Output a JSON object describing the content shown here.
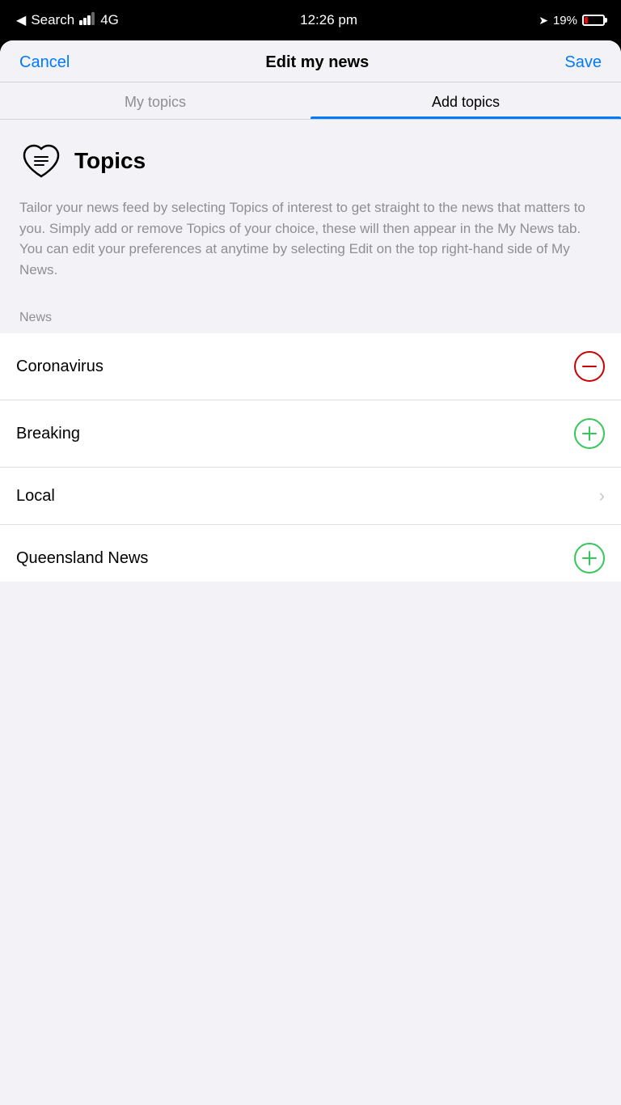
{
  "statusBar": {
    "carrier": "Search",
    "signal": "●●●●",
    "network": "4G",
    "time": "12:26 pm",
    "locationIcon": "▷",
    "battery": "19%"
  },
  "navBar": {
    "cancelLabel": "Cancel",
    "title": "Edit my news",
    "saveLabel": "Save"
  },
  "tabs": [
    {
      "id": "my-topics",
      "label": "My topics",
      "active": false
    },
    {
      "id": "add-topics",
      "label": "Add topics",
      "active": true
    }
  ],
  "topicsSection": {
    "heading": "Topics",
    "description": "Tailor your news feed by selecting Topics of interest to get straight to the news that matters to you. Simply add or remove Topics of your choice, these will then appear in the My News tab. You can edit your preferences at anytime by selecting Edit on the top right-hand side of My News."
  },
  "sectionLabel": "News",
  "topics": [
    {
      "name": "Coronavirus",
      "action": "remove",
      "icon": "minus"
    },
    {
      "name": "Breaking",
      "action": "add",
      "icon": "plus"
    },
    {
      "name": "Local",
      "action": "expand",
      "icon": "chevron"
    },
    {
      "name": "Queensland News",
      "action": "add",
      "icon": "plus"
    }
  ]
}
